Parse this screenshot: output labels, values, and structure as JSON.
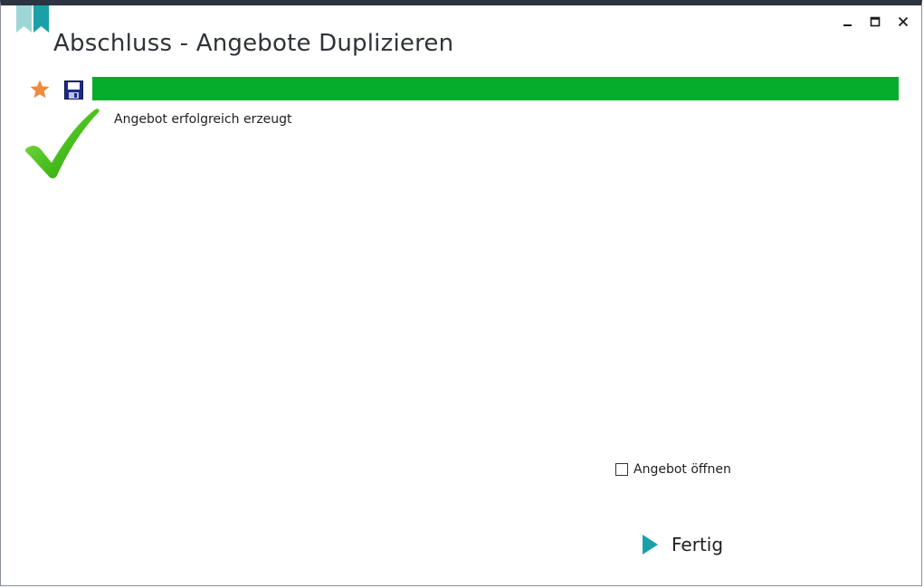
{
  "window": {
    "title": "Abschluss - Angebote Duplizieren",
    "controls": {
      "minimize_icon": "minimize-icon",
      "maximize_icon": "maximize-icon",
      "close_icon": "close-icon"
    }
  },
  "toolbar": {
    "favorite_icon": "star-icon",
    "save_icon": "floppy-disk-icon"
  },
  "progress": {
    "percent": 100,
    "color": "#06ac2c"
  },
  "status": {
    "icon": "checkmark-icon",
    "message": "Angebot erfolgreich erzeugt"
  },
  "options": {
    "open_offer_label": "Angebot öffnen",
    "open_offer_checked": false
  },
  "actions": {
    "finish_label": "Fertig",
    "finish_icon": "play-arrow-icon"
  },
  "colors": {
    "accent": "#1aa1a8",
    "success": "#06ac2c",
    "star": "#f08a3c",
    "titlebar": "#2b3440"
  }
}
